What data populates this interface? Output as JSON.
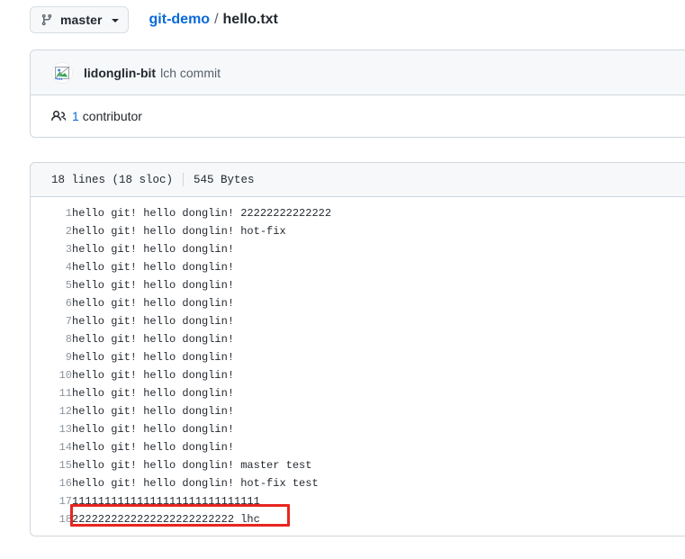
{
  "branch": {
    "name": "master",
    "icon": "git-branch-icon",
    "caret_icon": "chevron-down-icon"
  },
  "breadcrumb": {
    "repo": "git-demo",
    "separator": "/",
    "filename": "hello.txt"
  },
  "commit": {
    "avatar_icon": "broken-image-avatar-icon",
    "author": "lidonglin-bit",
    "message": "lch commit"
  },
  "contributors": {
    "icon": "people-icon",
    "count": "1",
    "label": "contributor"
  },
  "file_meta": {
    "lines": "18 lines (18 sloc)",
    "size": "545 Bytes"
  },
  "code": {
    "lines": [
      {
        "n": "1",
        "text": "hello git! hello donglin! 22222222222222"
      },
      {
        "n": "2",
        "text": "hello git! hello donglin! hot-fix"
      },
      {
        "n": "3",
        "text": "hello git! hello donglin!"
      },
      {
        "n": "4",
        "text": "hello git! hello donglin!"
      },
      {
        "n": "5",
        "text": "hello git! hello donglin!"
      },
      {
        "n": "6",
        "text": "hello git! hello donglin!"
      },
      {
        "n": "7",
        "text": "hello git! hello donglin!"
      },
      {
        "n": "8",
        "text": "hello git! hello donglin!"
      },
      {
        "n": "9",
        "text": "hello git! hello donglin!"
      },
      {
        "n": "10",
        "text": "hello git! hello donglin!"
      },
      {
        "n": "11",
        "text": "hello git! hello donglin!"
      },
      {
        "n": "12",
        "text": "hello git! hello donglin!"
      },
      {
        "n": "13",
        "text": "hello git! hello donglin!"
      },
      {
        "n": "14",
        "text": "hello git! hello donglin!"
      },
      {
        "n": "15",
        "text": "hello git! hello donglin! master test"
      },
      {
        "n": "16",
        "text": "hello git! hello donglin! hot-fix test"
      },
      {
        "n": "17",
        "text": "11111111111111111111111111111"
      },
      {
        "n": "18",
        "text": "2222222222222222222222222 lhc"
      }
    ]
  },
  "annotation": {
    "name": "red-highlight-box",
    "target_line": "18",
    "color": "#e8251f"
  },
  "colors": {
    "link": "#0969da",
    "text": "#24292f",
    "muted": "#57606a",
    "border": "#d0d7de",
    "header_bg": "#f6f8fa",
    "line_number": "#8c959f",
    "annotation": "#e8251f"
  }
}
